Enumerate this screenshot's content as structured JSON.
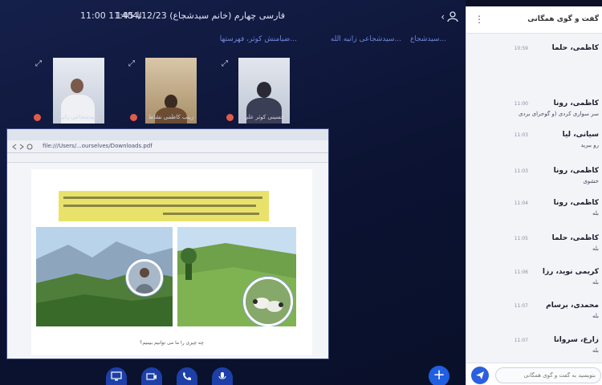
{
  "header": {
    "title": "فارسی چهارم (خانم سیدشجاع) 1404/12/23",
    "time_range": "11:00 تا 11:45",
    "presenters": [
      "سیدشجاعی زانیه الله...",
      "ضیامنش کوثر، فهرستها...",
      "سیدشجاع..."
    ]
  },
  "video_tiles": [
    {
      "name": "سیدشجاعی زانیه"
    },
    {
      "name": "زینب کاظمی نشاط"
    },
    {
      "name": "حسینی کوثر علی"
    }
  ],
  "share": {
    "url": "file:///Users/...ourselves/Downloads.pdf",
    "caption": "چه چیزی را ما می توانیم ببینیم؟"
  },
  "controls": [
    {
      "icon": "screen-share-icon"
    },
    {
      "icon": "camera-icon"
    },
    {
      "icon": "phone-icon"
    },
    {
      "icon": "microphone-icon"
    }
  ],
  "chat": {
    "title": "گفت و گوی همگانی",
    "input_placeholder": "بنویسید به گفت و گوی همگانی",
    "messages": [
      {
        "name": "کاظمی، حلما",
        "time": "10:59",
        "text": ""
      },
      {
        "name": "کاظمی، رونا",
        "time": "11:00",
        "text": "سر سواری کردی (و گوجرای بردی"
      },
      {
        "name": "سیانی، لیا",
        "time": "11:03",
        "text": "رو ببرید"
      },
      {
        "name": "کاظمی، رونا",
        "time": "11:03",
        "text": "خشوی"
      },
      {
        "name": "کاظمی، رونا",
        "time": "11:04",
        "text": "بله"
      },
      {
        "name": "کاظمی، حلما",
        "time": "11:05",
        "text": "بله"
      },
      {
        "name": "کریمی نوید، رزا",
        "time": "11:06",
        "text": "بله"
      },
      {
        "name": "محمدی، برسام",
        "time": "11:07",
        "text": "بله"
      },
      {
        "name": "زارع، سروانا",
        "time": "11:07",
        "text": "بله"
      }
    ]
  }
}
